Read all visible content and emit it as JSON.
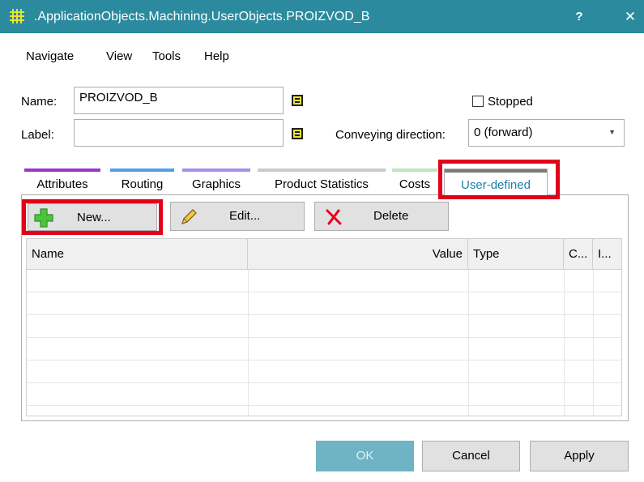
{
  "window": {
    "title": ".ApplicationObjects.Machining.UserObjects.PROIZVOD_B",
    "help_label": "?",
    "close_label": "✕"
  },
  "menu": {
    "items": [
      "Navigate",
      "View",
      "Tools",
      "Help"
    ]
  },
  "form": {
    "name_label": "Name:",
    "name_value": "PROIZVOD_B",
    "label_label": "Label:",
    "label_value": "",
    "stopped_label": "Stopped",
    "stopped_checked": false,
    "conveying_label": "Conveying direction:",
    "conveying_value": "0 (forward)"
  },
  "tabs": [
    {
      "label": "Attributes",
      "color": "#9b36c9"
    },
    {
      "label": "Routing",
      "color": "#4f9fe6"
    },
    {
      "label": "Graphics",
      "color": "#a98ee8"
    },
    {
      "label": "Product Statistics",
      "color": "#c9c9c9"
    },
    {
      "label": "Costs",
      "color": "#bfe6bf"
    },
    {
      "label": "User-defined",
      "color": "#7a7a7a",
      "active": true
    }
  ],
  "toolbar": {
    "new_label": "New...",
    "edit_label": "Edit...",
    "delete_label": "Delete"
  },
  "table": {
    "columns": [
      "Name",
      "Value",
      "Type",
      "C...",
      "I..."
    ],
    "rows": []
  },
  "dialog_buttons": {
    "ok_label": "OK",
    "cancel_label": "Cancel",
    "apply_label": "Apply"
  },
  "colors": {
    "titlebar": "#2b8a9e",
    "highlight": "#e3001b",
    "active_tab_text": "#1a7fa8"
  },
  "icons": {
    "app": "grid-icon",
    "new": "green-plus-icon",
    "edit": "pencil-icon",
    "delete": "red-x-icon"
  }
}
